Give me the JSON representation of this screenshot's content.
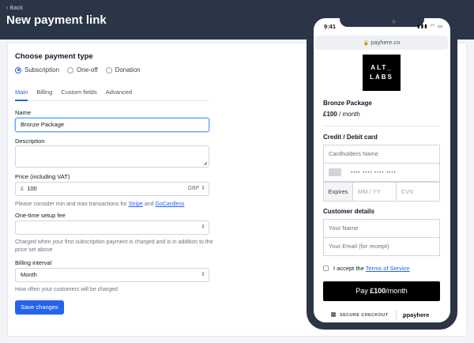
{
  "header": {
    "back_label": "‹ Back",
    "title": "New payment link"
  },
  "form": {
    "payment_type_title": "Choose payment type",
    "payment_types": [
      {
        "label": "Subscription",
        "selected": true
      },
      {
        "label": "One-off",
        "selected": false
      },
      {
        "label": "Donation",
        "selected": false
      }
    ],
    "tabs": [
      {
        "label": "Main",
        "active": true
      },
      {
        "label": "Billing",
        "active": false
      },
      {
        "label": "Custom fields",
        "active": false
      },
      {
        "label": "Advanced",
        "active": false
      }
    ],
    "name_label": "Name",
    "name_value": "Bronze Package",
    "description_label": "Description",
    "description_value": "",
    "price_label": "Price (including VAT)",
    "price_currency_symbol": "£",
    "price_value": "100",
    "price_currency": "GBP",
    "price_help_prefix": "Please consider min and max transactions for",
    "price_help_link1": "Stripe",
    "price_help_and": "and",
    "price_help_link2": "GoCardless",
    "setup_fee_label": "One-time setup fee",
    "setup_fee_value": "",
    "setup_fee_help": "Charged when your first subscription payment is charged and is in addition to the price set above",
    "billing_interval_label": "Billing interval",
    "billing_interval_value": "Month",
    "billing_interval_help": "How often your customers will be charged",
    "save_label": "Save changes"
  },
  "phone": {
    "status_time": "9:41",
    "status_icons": "▮▮▮ ◠ ▭",
    "url": "payhere.co",
    "logo_line1": "ALT_",
    "logo_line2": "LABS",
    "product_name": "Bronze Package",
    "price_amount": "£100",
    "price_period": " / month",
    "card_section_title": "Credit / Debit card",
    "card_name_placeholder": "Cardholders Name",
    "card_number_placeholder": "•••• •••• •••• ••••",
    "expires_label": "Expires",
    "expiry_placeholder": "MM / YY",
    "cvv_placeholder": "CVV",
    "customer_section_title": "Customer details",
    "customer_name_placeholder": "Your Name",
    "customer_email_placeholder": "Your Email (for receipt)",
    "terms_prefix": "I accept the",
    "terms_link": "Terms of Service",
    "pay_prefix": "Pay ",
    "pay_amount": "£100",
    "pay_suffix": "/month",
    "secure_label": "SECURE CHECKOUT",
    "brand_label": "payhere"
  },
  "colors": {
    "header_bg": "#2b3548",
    "accent": "#2563eb",
    "phone_frame": "#2c3547"
  }
}
